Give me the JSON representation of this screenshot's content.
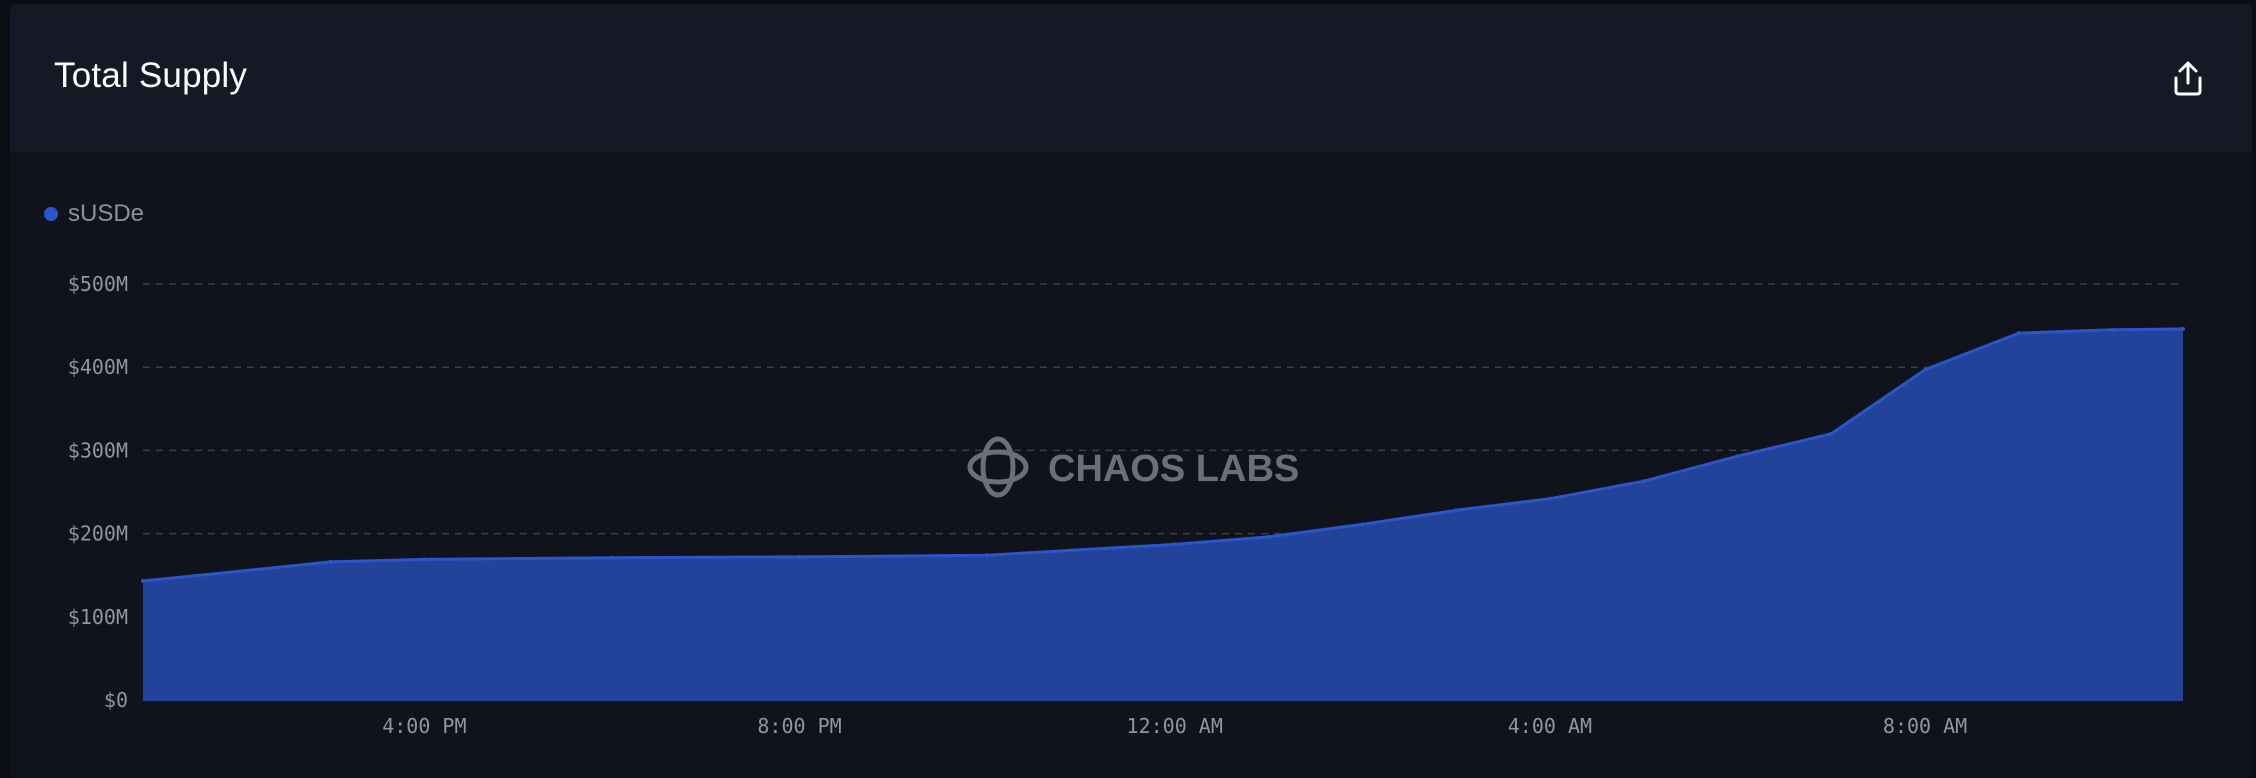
{
  "header": {
    "title": "Total Supply"
  },
  "icons": {
    "export": "share-upload-icon"
  },
  "watermark": {
    "text": "CHAOS LABS"
  },
  "colors": {
    "series": "#2b55c9",
    "fill": "#2447a3",
    "grid": "#3a3f4b"
  },
  "chart_data": {
    "type": "area",
    "legend_placement": "top-left",
    "grid": true,
    "ylim": [
      0,
      500
    ],
    "y_ticks": [
      {
        "value": 500,
        "label": "$500M"
      },
      {
        "value": 400,
        "label": "$400M"
      },
      {
        "value": 300,
        "label": "$300M"
      },
      {
        "value": 200,
        "label": "$200M"
      },
      {
        "value": 100,
        "label": "$100M"
      },
      {
        "value": 0,
        "label": "$0"
      }
    ],
    "x_hours_range": [
      13,
      34.75
    ],
    "x_ticks": [
      {
        "value": 16,
        "label": "4:00 PM"
      },
      {
        "value": 20,
        "label": "8:00 PM"
      },
      {
        "value": 24,
        "label": "12:00 AM"
      },
      {
        "value": 28,
        "label": "4:00 AM"
      },
      {
        "value": 32,
        "label": "8:00 AM"
      }
    ],
    "series": [
      {
        "name": "sUSDe",
        "points": [
          [
            13.0,
            143
          ],
          [
            15.0,
            166
          ],
          [
            16.0,
            169
          ],
          [
            18.0,
            171
          ],
          [
            20.0,
            172
          ],
          [
            22.0,
            174
          ],
          [
            24.0,
            187
          ],
          [
            25.0,
            196
          ],
          [
            26.0,
            211
          ],
          [
            27.0,
            228
          ],
          [
            28.0,
            242
          ],
          [
            29.0,
            263
          ],
          [
            30.0,
            293
          ],
          [
            31.0,
            320
          ],
          [
            32.0,
            397
          ],
          [
            33.0,
            441
          ],
          [
            34.0,
            445
          ],
          [
            34.75,
            446
          ]
        ]
      }
    ]
  }
}
